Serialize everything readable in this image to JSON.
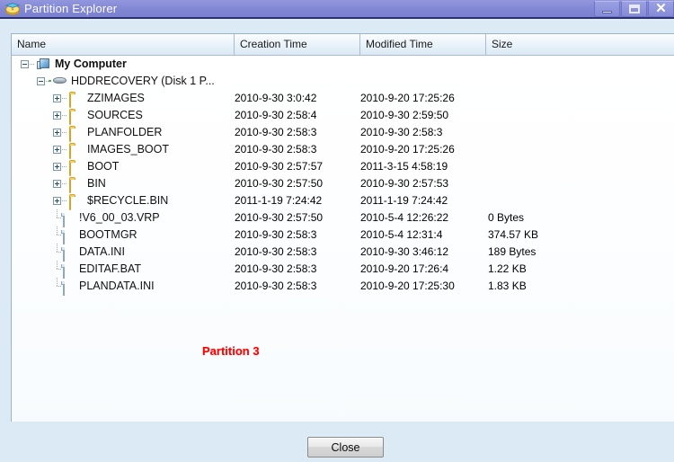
{
  "window": {
    "title": "Partition Explorer",
    "icon": "partition-explorer-icon",
    "controls": {
      "minimize_label": "Minimize",
      "maximize_label": "Maximize",
      "close_label": "Close"
    }
  },
  "columns": [
    {
      "key": "name",
      "label": "Name"
    },
    {
      "key": "creation",
      "label": "Creation Time"
    },
    {
      "key": "modified",
      "label": "Modified Time"
    },
    {
      "key": "size",
      "label": "Size"
    }
  ],
  "tree": [
    {
      "name": "My Computer",
      "icon": "computer-icon",
      "indent": 0,
      "expander": "minus",
      "bold": true,
      "creation": "",
      "modified": "",
      "size": ""
    },
    {
      "name": "HDDRECOVERY (Disk 1 P...",
      "icon": "drive-icon",
      "indent": 1,
      "expander": "minus",
      "bold": false,
      "creation": "",
      "modified": "",
      "size": ""
    },
    {
      "name": "ZZIMAGES",
      "icon": "folder-icon",
      "indent": 2,
      "expander": "plus",
      "bold": false,
      "creation": "2010-9-30 3:0:42",
      "modified": "2010-9-20 17:25:26",
      "size": ""
    },
    {
      "name": "SOURCES",
      "icon": "folder-icon",
      "indent": 2,
      "expander": "plus",
      "bold": false,
      "creation": "2010-9-30 2:58:4",
      "modified": "2010-9-30 2:59:50",
      "size": ""
    },
    {
      "name": "PLANFOLDER",
      "icon": "folder-icon",
      "indent": 2,
      "expander": "plus",
      "bold": false,
      "creation": "2010-9-30 2:58:3",
      "modified": "2010-9-30 2:58:3",
      "size": ""
    },
    {
      "name": "IMAGES_BOOT",
      "icon": "folder-icon",
      "indent": 2,
      "expander": "plus",
      "bold": false,
      "creation": "2010-9-30 2:58:3",
      "modified": "2010-9-20 17:25:26",
      "size": ""
    },
    {
      "name": "BOOT",
      "icon": "folder-icon",
      "indent": 2,
      "expander": "plus",
      "bold": false,
      "creation": "2010-9-30 2:57:57",
      "modified": "2011-3-15 4:58:19",
      "size": ""
    },
    {
      "name": "BIN",
      "icon": "folder-icon",
      "indent": 2,
      "expander": "plus",
      "bold": false,
      "creation": "2010-9-30 2:57:50",
      "modified": "2010-9-30 2:57:53",
      "size": ""
    },
    {
      "name": "$RECYCLE.BIN",
      "icon": "folder-icon",
      "indent": 2,
      "expander": "plus",
      "bold": false,
      "creation": "2011-1-19 7:24:42",
      "modified": "2011-1-19 7:24:42",
      "size": ""
    },
    {
      "name": "!V6_00_03.VRP",
      "icon": "file-icon",
      "indent": 2,
      "expander": "none",
      "bold": false,
      "creation": "2010-9-30 2:57:50",
      "modified": "2010-5-4 12:26:22",
      "size": "0 Bytes"
    },
    {
      "name": "BOOTMGR",
      "icon": "file-icon",
      "indent": 2,
      "expander": "none",
      "bold": false,
      "creation": "2010-9-30 2:58:3",
      "modified": "2010-5-4 12:31:4",
      "size": "374.57 KB"
    },
    {
      "name": "DATA.INI",
      "icon": "file-icon",
      "indent": 2,
      "expander": "none",
      "bold": false,
      "creation": "2010-9-30 2:58:3",
      "modified": "2010-9-30 3:46:12",
      "size": "189 Bytes"
    },
    {
      "name": "EDITAF.BAT",
      "icon": "file-icon",
      "indent": 2,
      "expander": "none",
      "bold": false,
      "creation": "2010-9-30 2:58:3",
      "modified": "2010-9-20 17:26:4",
      "size": "1.22 KB"
    },
    {
      "name": "PLANDATA.INI",
      "icon": "file-icon",
      "indent": 2,
      "expander": "none",
      "bold": false,
      "creation": "2010-9-30 2:58:3",
      "modified": "2010-9-20 17:25:30",
      "size": "1.83 KB"
    }
  ],
  "annotation": {
    "text": "Partition 3",
    "color": "#ff0000"
  },
  "footer": {
    "close_label": "Close"
  }
}
